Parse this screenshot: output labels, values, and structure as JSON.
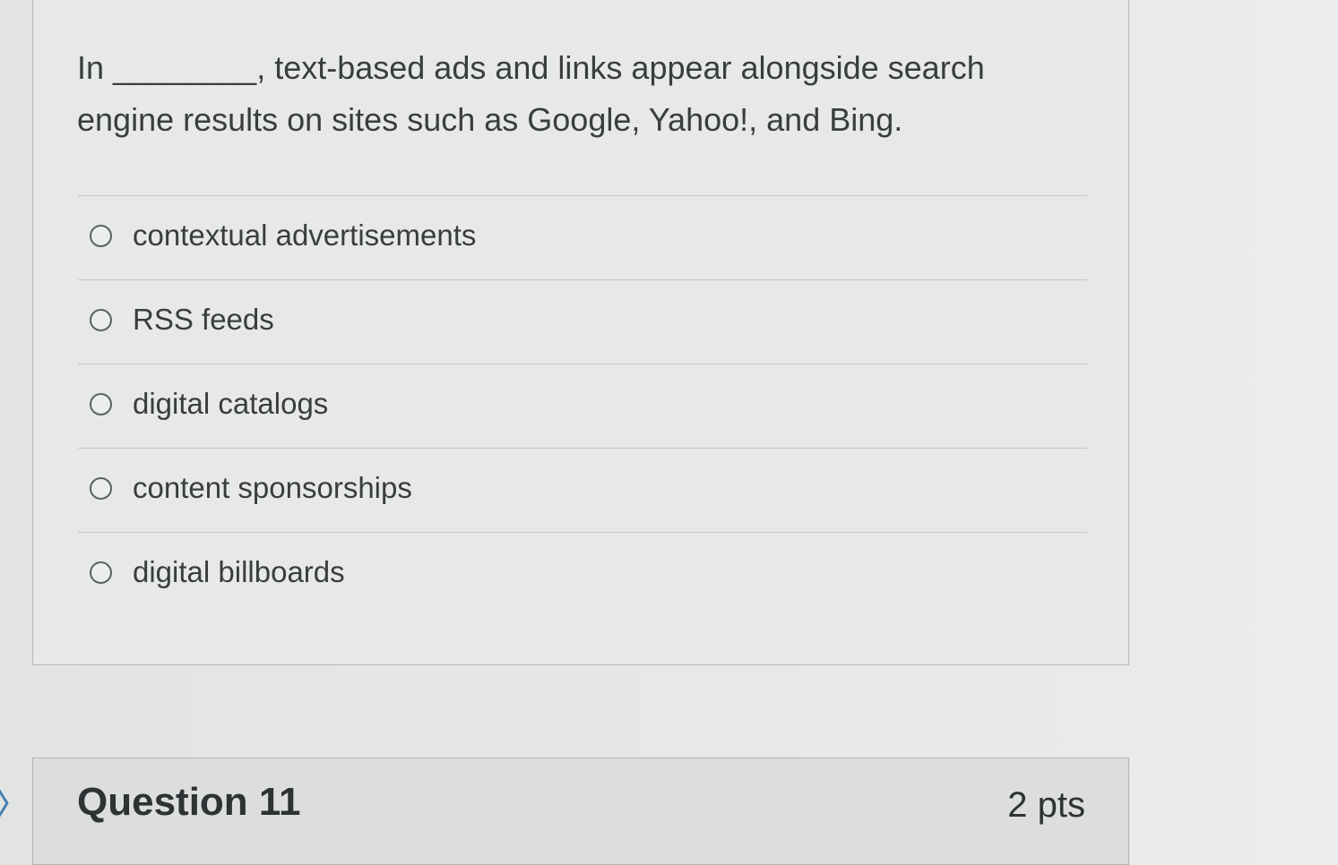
{
  "question": {
    "text": "In ________, text-based ads and links appear alongside search engine results on sites such as Google, Yahoo!, and Bing.",
    "answers": [
      {
        "label": "contextual advertisements"
      },
      {
        "label": "RSS feeds"
      },
      {
        "label": "digital catalogs"
      },
      {
        "label": "content sponsorships"
      },
      {
        "label": "digital billboards"
      }
    ]
  },
  "next_question": {
    "title": "Question 11",
    "points": "2 pts"
  },
  "icons": {
    "expand": "chevron-right-icon",
    "radio": "radio-unchecked-icon"
  }
}
